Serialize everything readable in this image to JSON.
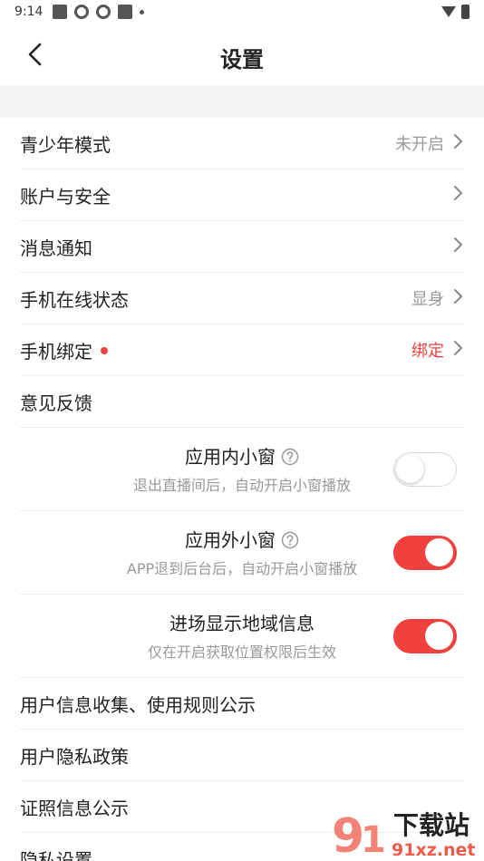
{
  "status_bar": {
    "time": "9:14"
  },
  "header": {
    "title": "设置"
  },
  "colors": {
    "accent": "#f0413e",
    "muted": "#999999",
    "divider": "#ececec",
    "section_bg": "#f5f5f5"
  },
  "rows": [
    {
      "label": "青少年模式",
      "value": "未开启",
      "has_chevron": true
    },
    {
      "label": "账户与安全",
      "has_chevron": true
    },
    {
      "label": "消息通知",
      "has_chevron": true
    },
    {
      "label": "手机在线状态",
      "value": "显身",
      "has_chevron": true
    },
    {
      "label": "手机绑定",
      "value": "绑定",
      "has_chevron": true,
      "badge": "red-dot"
    },
    {
      "label": "意见反馈"
    },
    {
      "label": "应用内小窗",
      "subtitle": "退出直播间后，自动开启小窗播放",
      "toggle": false,
      "help_icon": true
    },
    {
      "label": "应用外小窗",
      "subtitle": "APP退到后台后，自动开启小窗播放",
      "toggle": true,
      "help_icon": true
    },
    {
      "label": "进场显示地域信息",
      "subtitle": "仅在开启获取位置权限后生效",
      "toggle": true
    },
    {
      "label": "用户信息收集、使用规则公示"
    },
    {
      "label": "用户隐私政策"
    },
    {
      "label": "证照信息公示"
    },
    {
      "label": "隐私设置"
    }
  ],
  "watermark": {
    "brand": "下载站",
    "domain": "91xz.net"
  }
}
